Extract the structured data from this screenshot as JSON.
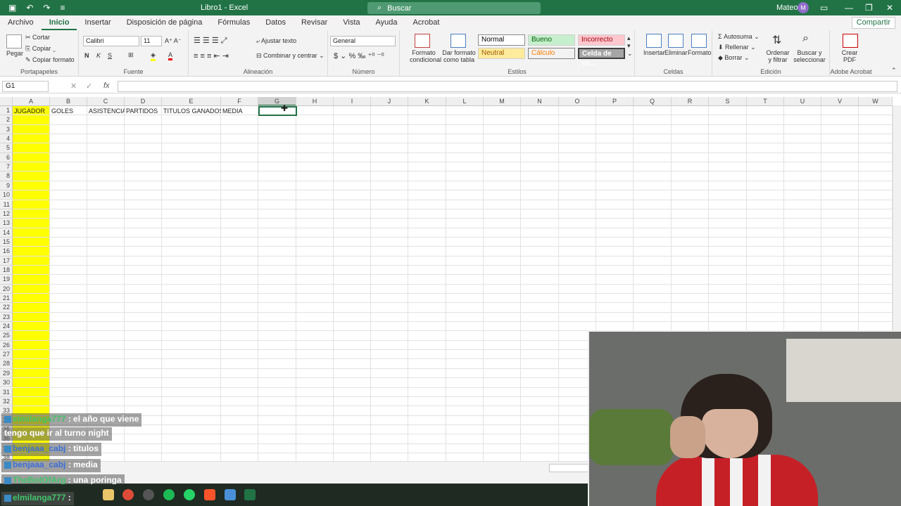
{
  "titlebar": {
    "doc_title": "Libro1 - Excel",
    "search_placeholder": "Buscar",
    "user_name": "Mateo",
    "user_initial": "M"
  },
  "menu": {
    "items": [
      "Archivo",
      "Inicio",
      "Insertar",
      "Disposición de página",
      "Fórmulas",
      "Datos",
      "Revisar",
      "Vista",
      "Ayuda",
      "Acrobat"
    ],
    "active": "Inicio",
    "share": "Compartir"
  },
  "ribbon": {
    "portapapeles": {
      "label": "Portapapeles",
      "pegar": "Pegar",
      "cortar": "Cortar",
      "copiar": "Copiar",
      "copiar_formato": "Copiar formato"
    },
    "fuente": {
      "label": "Fuente",
      "font": "Calibri",
      "size": "11"
    },
    "alineacion": {
      "label": "Alineación",
      "ajustar": "Ajustar texto",
      "combinar": "Combinar y centrar"
    },
    "numero": {
      "label": "Número",
      "format": "General"
    },
    "estilos": {
      "label": "Estilos",
      "formato_condicional": "Formato condicional",
      "dar_formato": "Dar formato como tabla",
      "styles": [
        {
          "name": "Normal",
          "bg": "#ffffff",
          "fg": "#000000"
        },
        {
          "name": "Bueno",
          "bg": "#c6efce",
          "fg": "#006100"
        },
        {
          "name": "Incorrecto",
          "bg": "#ffc7ce",
          "fg": "#9c0006"
        },
        {
          "name": "Neutral",
          "bg": "#ffeb9c",
          "fg": "#9c5700"
        },
        {
          "name": "Cálculo",
          "bg": "#f2f2f2",
          "fg": "#fa7d00"
        },
        {
          "name": "Celda de co...",
          "bg": "#a5a5a5",
          "fg": "#ffffff"
        }
      ]
    },
    "celdas": {
      "label": "Celdas",
      "insertar": "Insertar",
      "eliminar": "Eliminar",
      "formato": "Formato"
    },
    "edicion": {
      "label": "Edición",
      "autosuma": "Autosuma",
      "rellenar": "Rellenar",
      "borrar": "Borrar",
      "ordenar": "Ordenar y filtrar",
      "buscar": "Buscar y seleccionar"
    },
    "acrobat": {
      "label": "Adobe Acrobat",
      "crear": "Crear PDF"
    }
  },
  "formula_bar": {
    "name_box": "G1",
    "fx": "fx",
    "value": ""
  },
  "sheet": {
    "columns": [
      "A",
      "B",
      "C",
      "D",
      "E",
      "F",
      "G",
      "H",
      "I",
      "J",
      "K",
      "L",
      "M",
      "N",
      "O",
      "P",
      "Q",
      "R",
      "S",
      "T",
      "U",
      "V",
      "W"
    ],
    "rows": [
      "1",
      "2",
      "3",
      "4",
      "5",
      "6",
      "7",
      "8",
      "9",
      "10",
      "11",
      "12",
      "13",
      "14",
      "15",
      "16",
      "17",
      "18",
      "19",
      "20",
      "21",
      "22",
      "23",
      "24",
      "25",
      "26",
      "27",
      "28",
      "29",
      "30",
      "31",
      "32",
      "33",
      "34",
      "35",
      "36",
      "37",
      "38"
    ],
    "row1": [
      "JUGADOR",
      "GOLES",
      "ASISTENCIAS",
      "PARTIDOS",
      "TITULOS GANADOS",
      "MEDIA"
    ],
    "selected_cell": "G1",
    "highlight_color": "#ffff00"
  },
  "chat": [
    {
      "user": "elmilanga777",
      "text": ": el año que viene"
    },
    {
      "user": "",
      "text": "tengo que ir al turno night"
    },
    {
      "user": "benjaaa_cabj",
      "text": ": titulos"
    },
    {
      "user": "benjaaa_cabj",
      "text": ": media"
    },
    {
      "user": "TheBotOfArg",
      "text": ": una poringa"
    },
    {
      "user": "elmilanga777",
      "text": ":"
    }
  ]
}
